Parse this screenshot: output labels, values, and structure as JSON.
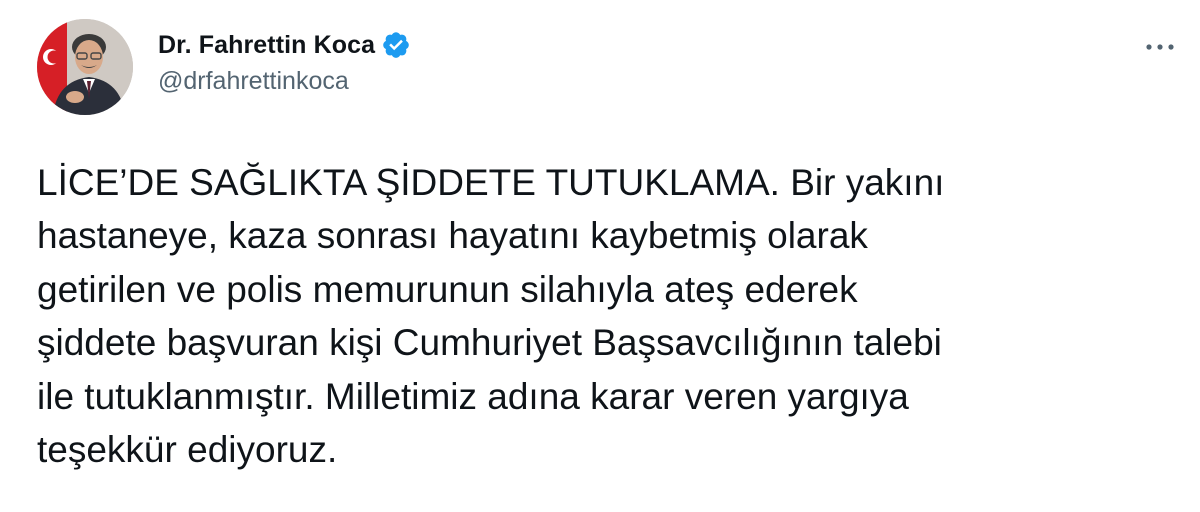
{
  "author": {
    "display_name": "Dr. Fahrettin Koca",
    "handle": "@drfahrettinkoca",
    "verified": true
  },
  "icons": {
    "verified": "verified-badge-icon",
    "more": "more-options-icon",
    "avatar": "profile-photo"
  },
  "tweet": {
    "text": "LİCE’DE SAĞLIKTA ŞİDDETE TUTUKLAMA. Bir yakını\nhastaneye, kaza sonrası hayatını kaybetmiş olarak\ngetirilen ve polis memurunun silahıyla ateş ederek\nşiddete başvuran kişi Cumhuriyet Başsavcılığının talebi\nile tutuklanmıştır. Milletimiz adına karar veren yargıya\nteşekkür ediyoruz."
  },
  "colors": {
    "text": "#0f1419",
    "secondary": "#536471",
    "verified_blue": "#1d9bf0"
  }
}
